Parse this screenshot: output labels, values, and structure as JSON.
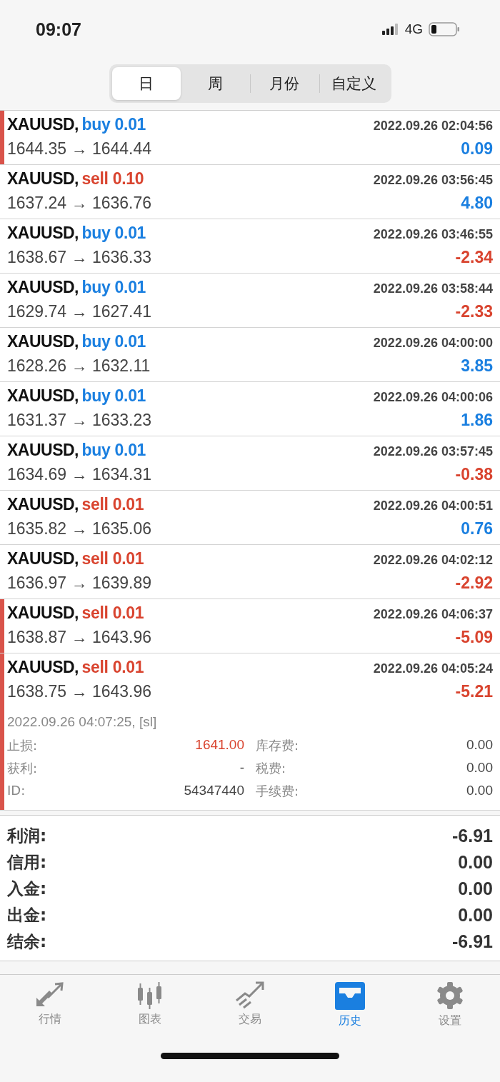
{
  "status_bar": {
    "time": "09:07",
    "network": "4G"
  },
  "period_tabs": [
    {
      "label": "日",
      "selected": true
    },
    {
      "label": "周",
      "selected": false
    },
    {
      "label": "月份",
      "selected": false
    },
    {
      "label": "自定义",
      "selected": false
    }
  ],
  "deals": [
    {
      "symbol": "XAUUSD,",
      "type": "buy 0.01",
      "color": "#1a7fe0",
      "time": "2022.09.26 02:04:56",
      "prices": "1644.35 → 1644.44",
      "profit": {
        "text": "0.09",
        "color": "#1a7fe0"
      },
      "marked": true
    },
    {
      "symbol": "XAUUSD,",
      "type": "sell 0.10",
      "color": "#d9442f",
      "time": "2022.09.26 03:56:45",
      "prices": "1637.24 → 1636.76",
      "profit": {
        "text": "4.80",
        "color": "#1a7fe0"
      },
      "marked": false
    },
    {
      "symbol": "XAUUSD,",
      "type": "buy 0.01",
      "color": "#1a7fe0",
      "time": "2022.09.26 03:46:55",
      "prices": "1638.67 → 1636.33",
      "profit": {
        "text": "-2.34",
        "color": "#d9442f"
      },
      "marked": false
    },
    {
      "symbol": "XAUUSD,",
      "type": "buy 0.01",
      "color": "#1a7fe0",
      "time": "2022.09.26 03:58:44",
      "prices": "1629.74 → 1627.41",
      "profit": {
        "text": "-2.33",
        "color": "#d9442f"
      },
      "marked": false
    },
    {
      "symbol": "XAUUSD,",
      "type": "buy 0.01",
      "color": "#1a7fe0",
      "time": "2022.09.26 04:00:00",
      "prices": "1628.26 → 1632.11",
      "profit": {
        "text": "3.85",
        "color": "#1a7fe0"
      },
      "marked": false
    },
    {
      "symbol": "XAUUSD,",
      "type": "buy 0.01",
      "color": "#1a7fe0",
      "time": "2022.09.26 04:00:06",
      "prices": "1631.37 → 1633.23",
      "profit": {
        "text": "1.86",
        "color": "#1a7fe0"
      },
      "marked": false
    },
    {
      "symbol": "XAUUSD,",
      "type": "buy 0.01",
      "color": "#1a7fe0",
      "time": "2022.09.26 03:57:45",
      "prices": "1634.69 → 1634.31",
      "profit": {
        "text": "-0.38",
        "color": "#d9442f"
      },
      "marked": false
    },
    {
      "symbol": "XAUUSD,",
      "type": "sell 0.01",
      "color": "#d9442f",
      "time": "2022.09.26 04:00:51",
      "prices": "1635.82 → 1635.06",
      "profit": {
        "text": "0.76",
        "color": "#1a7fe0"
      },
      "marked": false
    },
    {
      "symbol": "XAUUSD,",
      "type": "sell 0.01",
      "color": "#d9442f",
      "time": "2022.09.26 04:02:12",
      "prices": "1636.97 → 1639.89",
      "profit": {
        "text": "-2.92",
        "color": "#d9442f"
      },
      "marked": false
    },
    {
      "symbol": "XAUUSD,",
      "type": "sell 0.01",
      "color": "#d9442f",
      "time": "2022.09.26 04:06:37",
      "prices": "1638.87 → 1643.96",
      "profit": {
        "text": "-5.09",
        "color": "#d9442f"
      },
      "marked": true
    },
    {
      "symbol": "XAUUSD,",
      "type": "sell 0.01",
      "color": "#d9442f",
      "time": "2022.09.26 04:05:24",
      "prices": "1638.75 → 1643.96",
      "profit": {
        "text": "-5.21",
        "color": "#d9442f"
      },
      "marked": true,
      "details": {
        "close_info": "2022.09.26 04:07:25, [sl]",
        "rows": [
          {
            "left": {
              "label": "止损:",
              "value": "1641.00",
              "color": "#d9442f"
            },
            "right": {
              "label": "库存费:",
              "value": "0.00",
              "color": "#444444"
            }
          },
          {
            "left": {
              "label": "获利:",
              "value": "-",
              "color": "#444444"
            },
            "right": {
              "label": "税费:",
              "value": "0.00",
              "color": "#444444"
            }
          },
          {
            "left": {
              "label": "ID:",
              "value": "54347440",
              "color": "#444444"
            },
            "right": {
              "label": "手续费:",
              "value": "0.00",
              "color": "#444444"
            }
          }
        ]
      }
    }
  ],
  "summary": [
    {
      "label": "利润:",
      "value": "-6.91"
    },
    {
      "label": "信用:",
      "value": "0.00"
    },
    {
      "label": "入金:",
      "value": "0.00"
    },
    {
      "label": "出金:",
      "value": "0.00"
    },
    {
      "label": "结余:",
      "value": "-6.91"
    }
  ],
  "tab_bar": [
    {
      "kind": "quotes",
      "label": "行情",
      "selected": false
    },
    {
      "kind": "chart",
      "label": "图表",
      "selected": false
    },
    {
      "kind": "trade",
      "label": "交易",
      "selected": false
    },
    {
      "kind": "history",
      "label": "历史",
      "selected": true
    },
    {
      "kind": "settings",
      "label": "设置",
      "selected": false
    }
  ]
}
